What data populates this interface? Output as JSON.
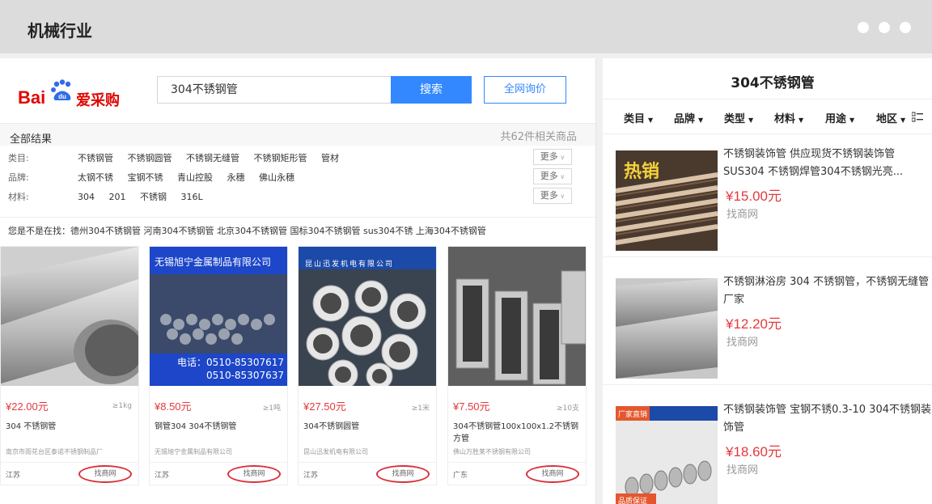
{
  "window": {
    "title": "机械行业"
  },
  "header": {
    "logo_bai": "Bai",
    "logo_du": "du",
    "logo_brand": "爱采购",
    "search_value": "304不锈钢管",
    "search_button": "搜索",
    "inquire_button": "全网询价"
  },
  "results": {
    "all_label": "全部结果",
    "count_text": "共62件相关商品"
  },
  "filters": [
    {
      "label": "类目:",
      "options": [
        "不锈钢管",
        "不锈钢圆管",
        "不锈钢无缝管",
        "不锈钢矩形管",
        "管材"
      ],
      "more": "更多"
    },
    {
      "label": "品牌:",
      "options": [
        "太钢不锈",
        "宝钢不锈",
        "青山控股",
        "永穗",
        "佛山永穗"
      ],
      "more": "更多"
    },
    {
      "label": "材料:",
      "options": [
        "304",
        "201",
        "不锈钢",
        "316L"
      ],
      "more": "更多"
    }
  ],
  "suggest": {
    "text": "您是不是在找：德州304不锈钢管 河南304不锈钢管 北京304不锈钢管 国标304不锈钢管 sus304不锈 上海304不锈钢管"
  },
  "products": [
    {
      "price": "¥22.00元",
      "moq": "≥1kg",
      "name": "304 不锈钢管",
      "seller": "南京市雨花台区泰诺不锈钢制品厂",
      "province": "江苏",
      "source": "找商网",
      "image_text": ""
    },
    {
      "price": "¥8.50元",
      "moq": "≥1吨",
      "name": "钢管304 304不锈钢管",
      "seller": "无锡旭宁金属制品有限公司",
      "province": "江苏",
      "source": "找商网",
      "image_text": "无锡旭宁金属制品有限公司",
      "phone1": "电话：0510-85307617",
      "phone2": "0510-85307637"
    },
    {
      "price": "¥27.50元",
      "moq": "≥1米",
      "name": "304不锈钢圆管",
      "seller": "昆山迅发机电有限公司",
      "province": "江苏",
      "source": "找商网",
      "image_text": "昆山迅发机电有限公司"
    },
    {
      "price": "¥7.50元",
      "moq": "≥10支",
      "name": "304不锈钢管100x100x1.2不锈钢方管",
      "seller": "佛山万胜莱不锈钢有限公司",
      "province": "广东",
      "source": "找商网",
      "image_text": ""
    }
  ],
  "right_panel": {
    "title": "304不锈钢管",
    "tabs": [
      "类目",
      "品牌",
      "类型",
      "材料",
      "用途",
      "地区"
    ],
    "items": [
      {
        "name": "不锈钢装饰管 供应现货不锈钢装饰管SUS304 不锈钢焊管304不锈钢光亮...",
        "price": "¥15.00元",
        "source": "找商网",
        "badge": "热销"
      },
      {
        "name": "不锈钢淋浴房 304 不锈钢管，不锈钢无缝管厂家",
        "price": "¥12.20元",
        "source": "找商网",
        "badge": ""
      },
      {
        "name": "不锈钢装饰管 宝钢不锈0.3-10 304不锈钢装饰管",
        "price": "¥18.60元",
        "source": "找商网",
        "badge": "厂家直销",
        "badge2": "品质保证"
      }
    ]
  },
  "colors": {
    "accent": "#3388ff",
    "price": "#e4393c",
    "brand_red": "#e10601"
  }
}
